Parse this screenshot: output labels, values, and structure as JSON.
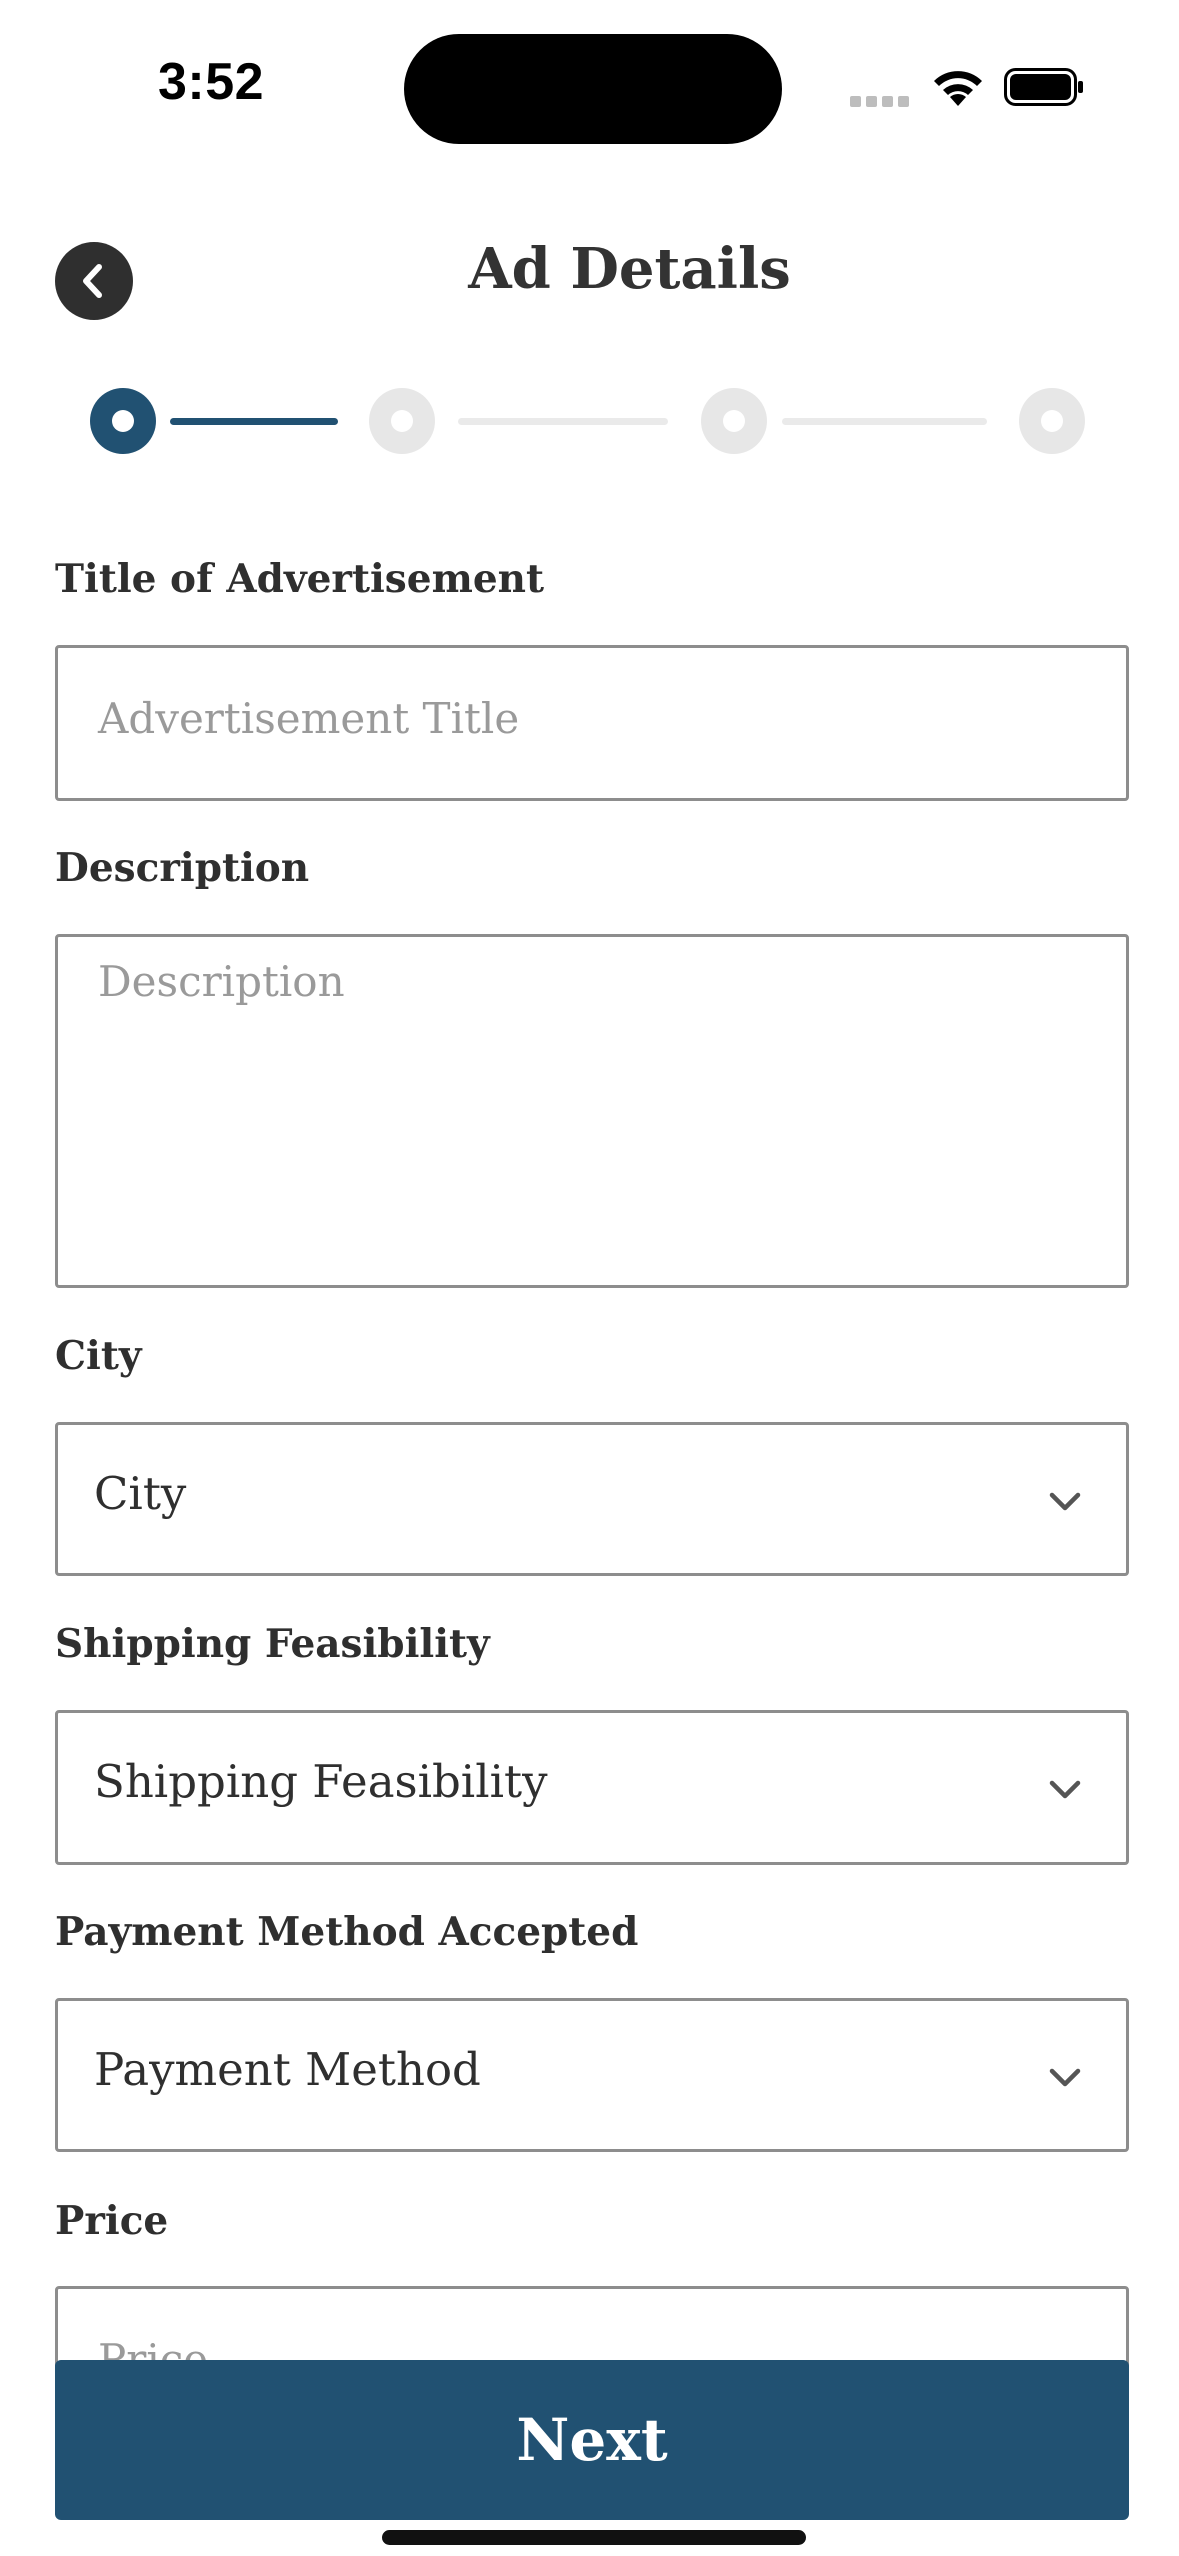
{
  "status_bar": {
    "time": "3:52"
  },
  "header": {
    "title": "Ad Details"
  },
  "stepper": {
    "total_steps": 4,
    "current_step": 1
  },
  "form": {
    "title": {
      "label": "Title of Advertisement",
      "placeholder": "Advertisement Title"
    },
    "description": {
      "label": "Description",
      "placeholder": "Description"
    },
    "city": {
      "label": "City",
      "value": "City"
    },
    "shipping": {
      "label": "Shipping Feasibility",
      "value": "Shipping Feasibility"
    },
    "payment": {
      "label": "Payment Method Accepted",
      "value": "Payment Method"
    },
    "price": {
      "label": "Price",
      "placeholder": "Price"
    }
  },
  "actions": {
    "next_label": "Next"
  },
  "colors": {
    "accent": "#215172",
    "inactive": "#e7e7e7",
    "border": "#8d8d8d"
  }
}
